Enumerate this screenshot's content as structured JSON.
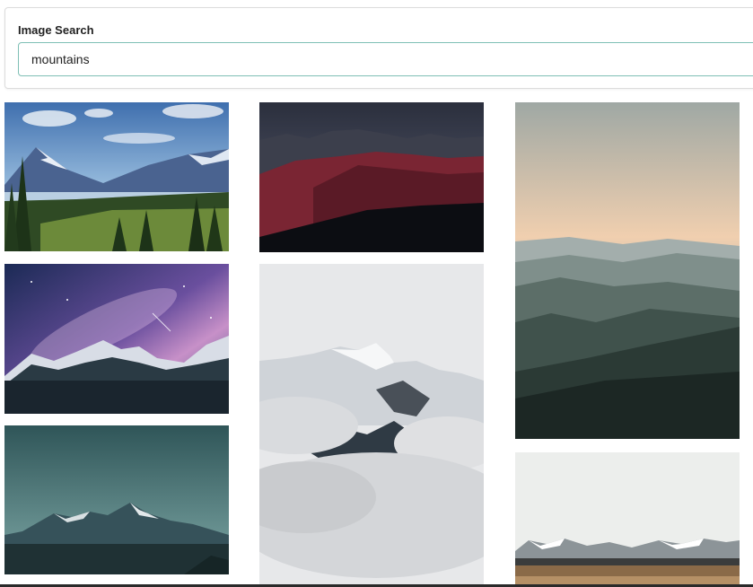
{
  "search": {
    "label": "Image Search",
    "value": "mountains"
  },
  "results": [
    {
      "icon": "mountain-lake-forest-photo"
    },
    {
      "icon": "red-mountain-ridge-photo"
    },
    {
      "icon": "misty-hills-sunset-photo"
    },
    {
      "icon": "milky-way-mountain-photo"
    },
    {
      "icon": "snowy-peak-clouds-photo"
    },
    {
      "icon": "teal-sky-mountain-photo"
    },
    {
      "icon": "snowy-range-desert-photo"
    }
  ]
}
